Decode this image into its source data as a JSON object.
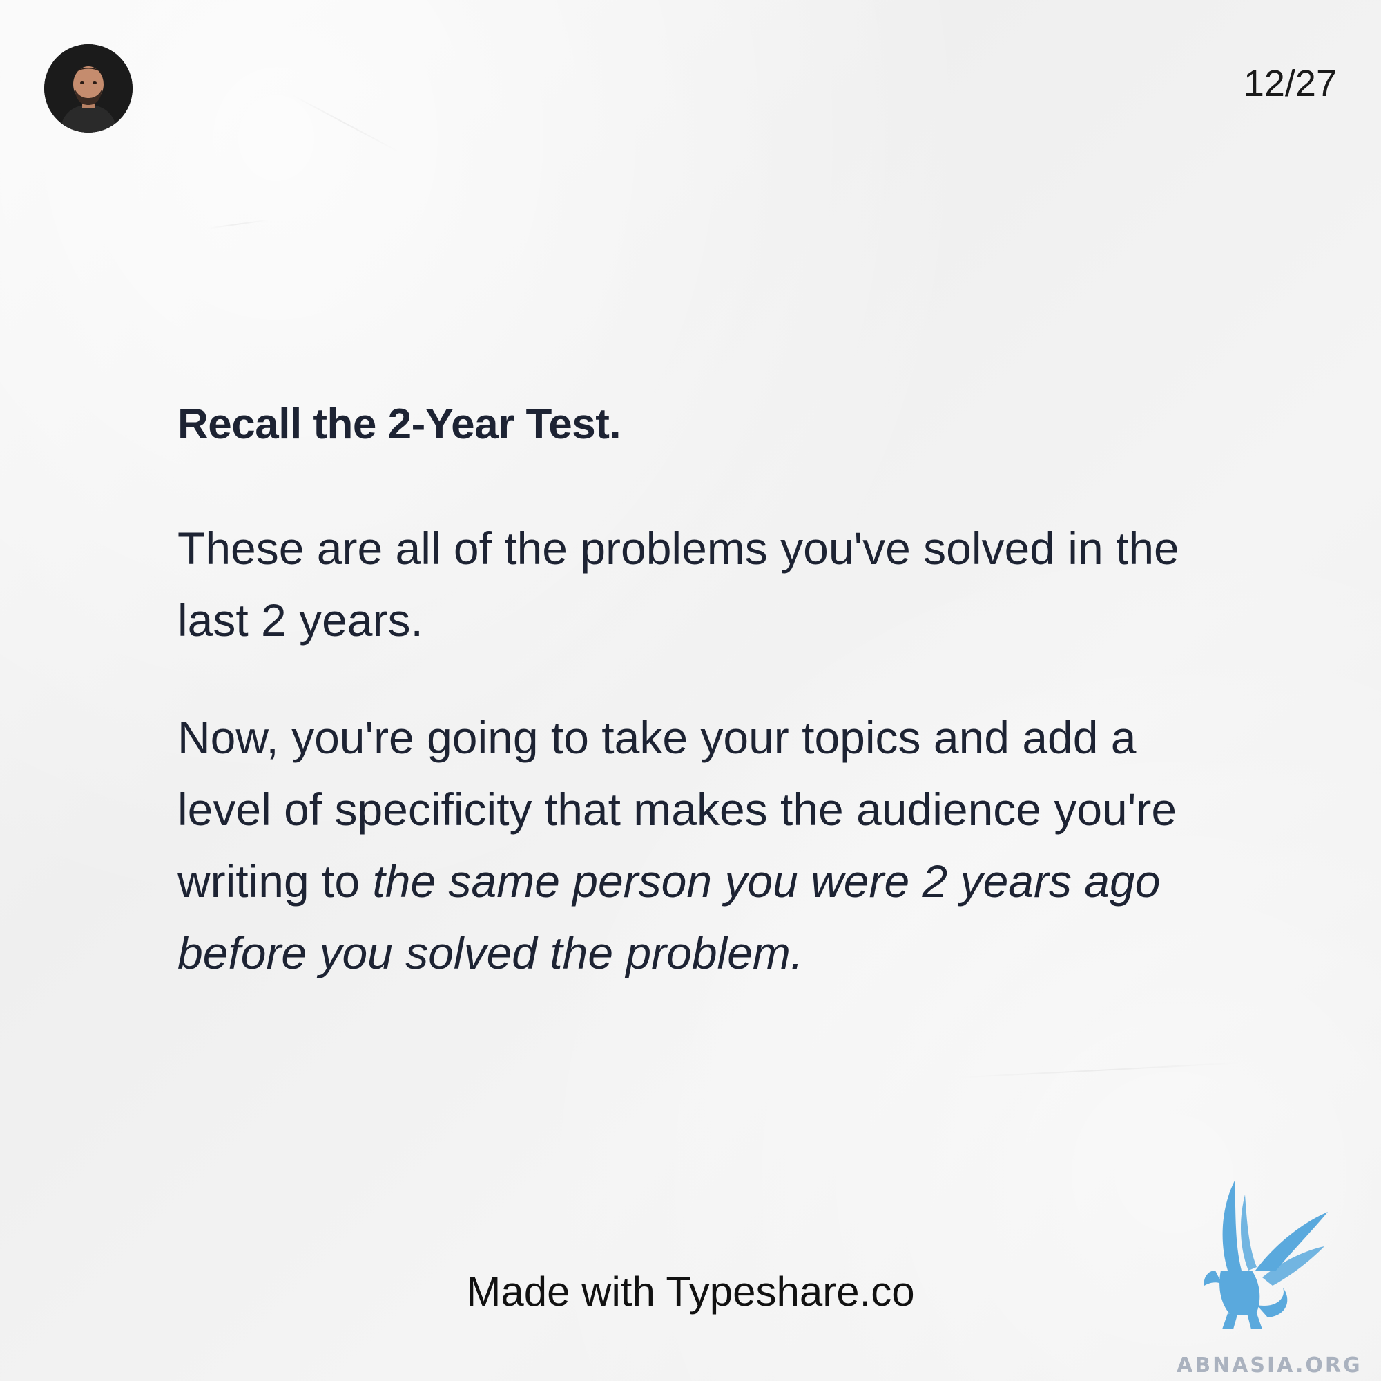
{
  "header": {
    "avatar_icon": "author-avatar-icon",
    "page_counter": "12/27"
  },
  "content": {
    "heading": "Recall the 2-Year Test.",
    "paragraph1": "These are all of the problems you've solved in the last 2 years.",
    "paragraph2_plain": "Now, you're going to take your topics and add a level of specificity that makes the audience you're writing to ",
    "paragraph2_italic": "the same person you were 2 years ago before you solved the problem."
  },
  "footer": {
    "text": "Made with Typeshare.co"
  },
  "watermark": {
    "icon": "griffin-logo-icon",
    "text": "ABNASIA.ORG",
    "color": "#5aa9dd"
  },
  "colors": {
    "background": "#f3f3f3",
    "text": "#1d2333"
  }
}
